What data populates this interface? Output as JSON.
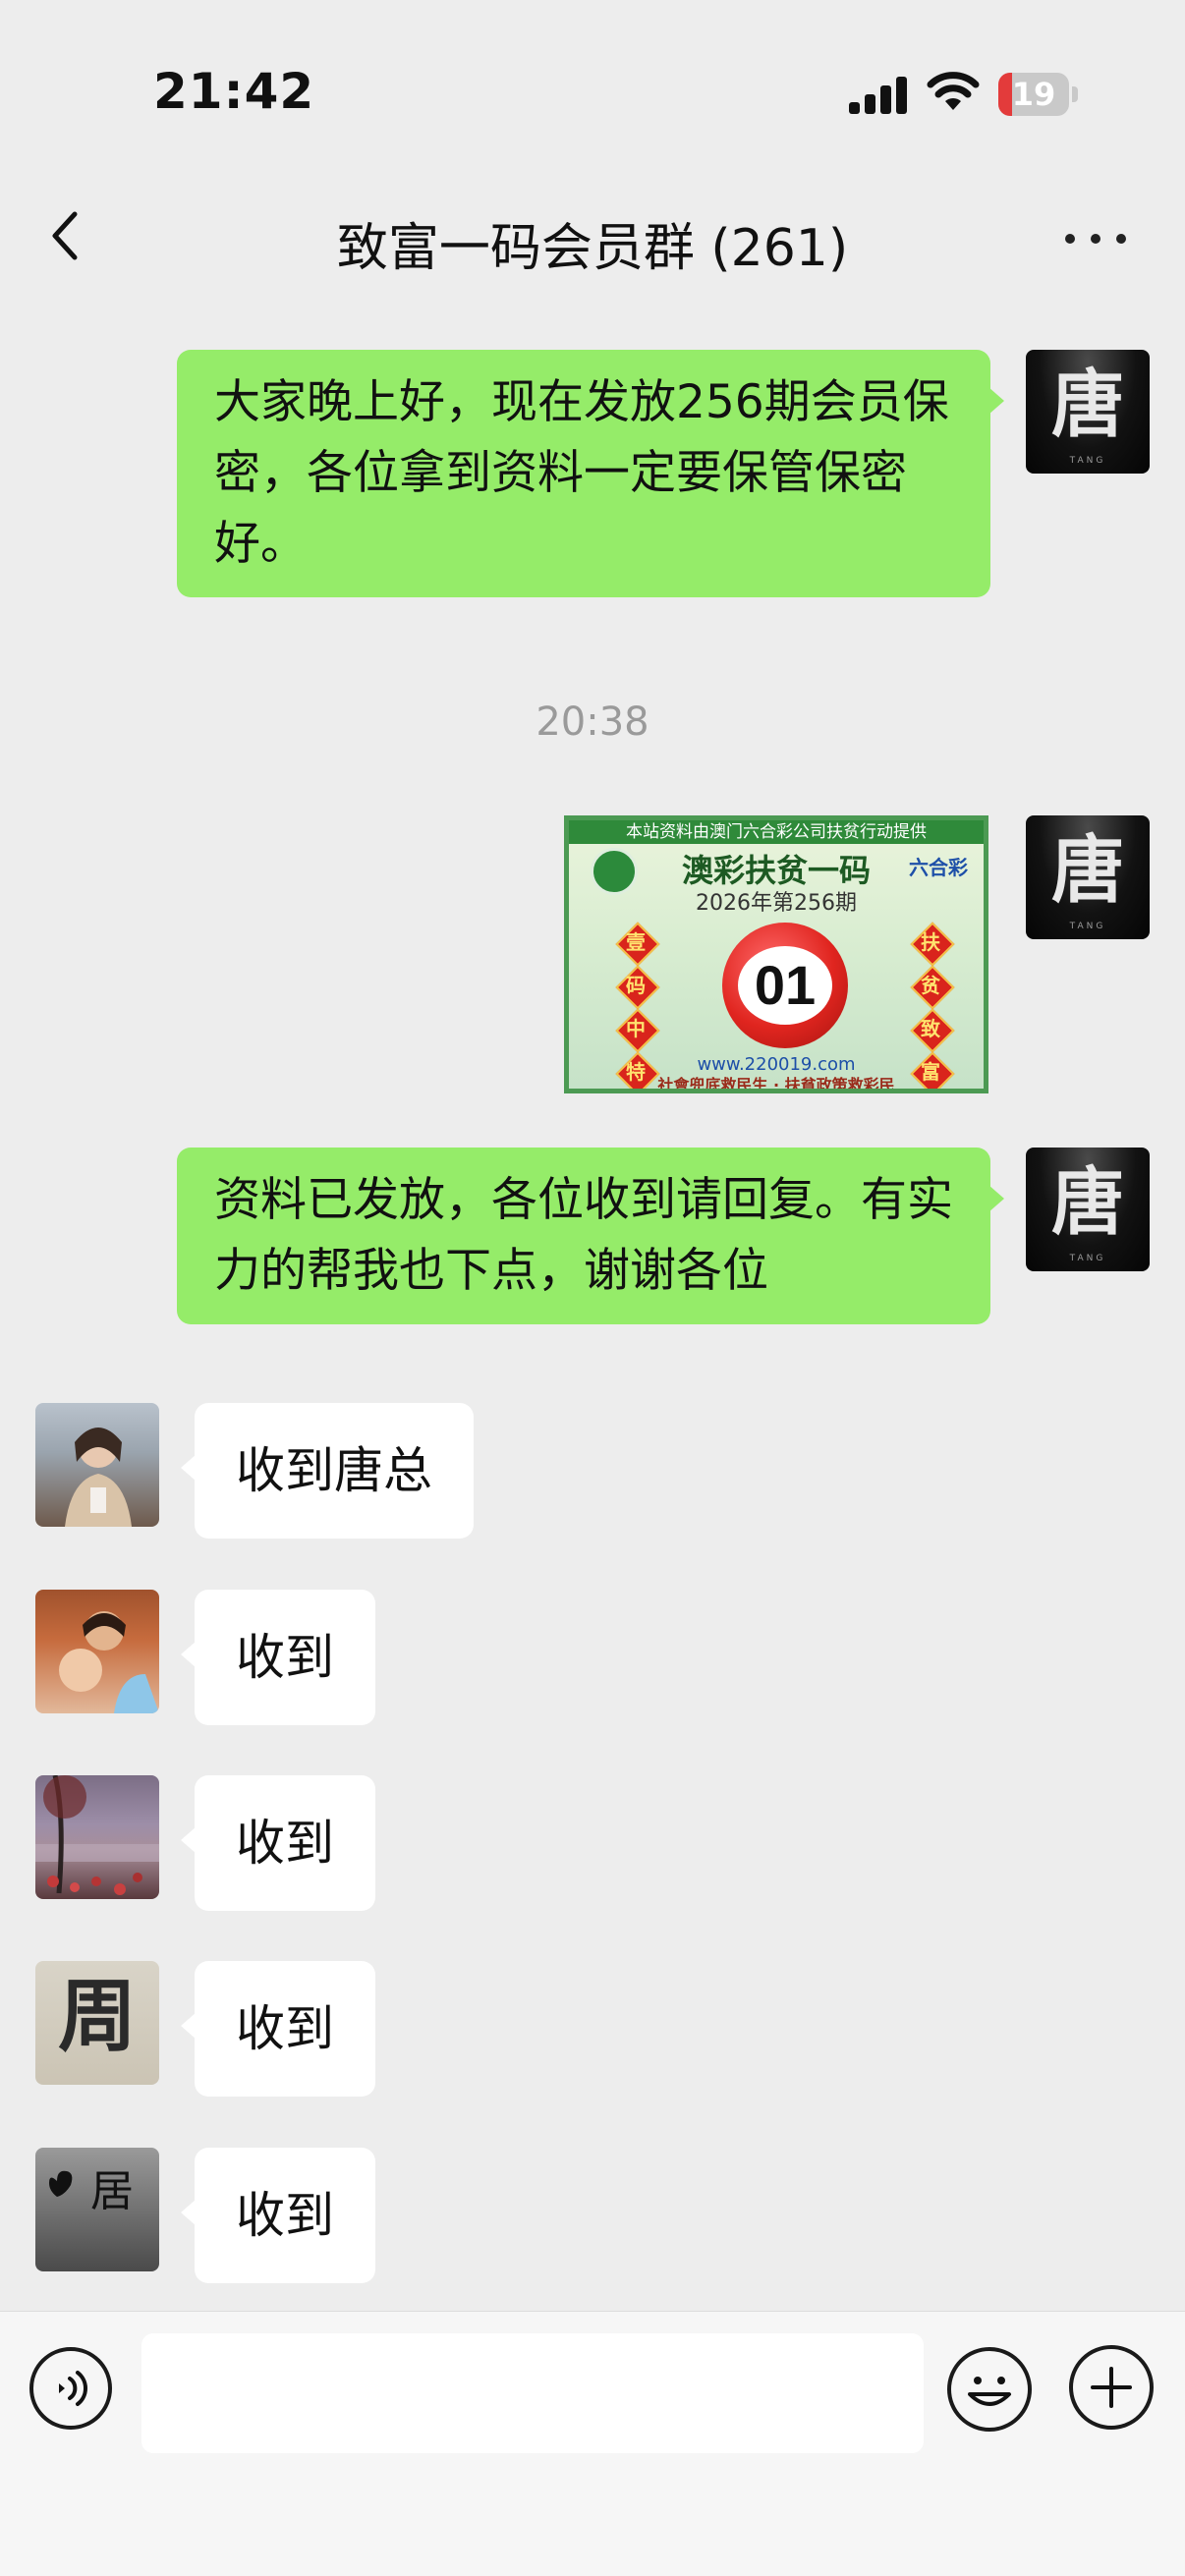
{
  "status_bar": {
    "time": "21:42",
    "battery": "19",
    "battery_level": 0.19
  },
  "nav": {
    "title": "致富一码会员群 (261)"
  },
  "messages": {
    "msg1": "大家晚上好，现在发放256期会员保密，各位拿到资料一定要保管保密好。",
    "timestamp": "20:38",
    "image": {
      "top_banner": "本站资料由澳门六合彩公司扶贫行动提供",
      "title": "澳彩扶贫一码",
      "issue": "2026年第256期",
      "logo": "六合彩",
      "left_chars": [
        "壹",
        "码",
        "中",
        "特"
      ],
      "right_chars": [
        "扶",
        "贫",
        "致",
        "富"
      ],
      "number": "01",
      "url": "www.220019.com",
      "bottom_text": "社會兜底救民生 · 扶貧政策救彩民"
    },
    "msg2": "资料已发放，各位收到请回复。有实力的帮我也下点，谢谢各位",
    "replies": [
      "收到唐总",
      "收到",
      "收到",
      "收到",
      "收到"
    ]
  },
  "avatars": {
    "tang_glyph": "唐",
    "tang_small": "TANG",
    "zhou_glyph": "周",
    "ju_glyph": "居"
  },
  "input": {
    "placeholder": ""
  }
}
